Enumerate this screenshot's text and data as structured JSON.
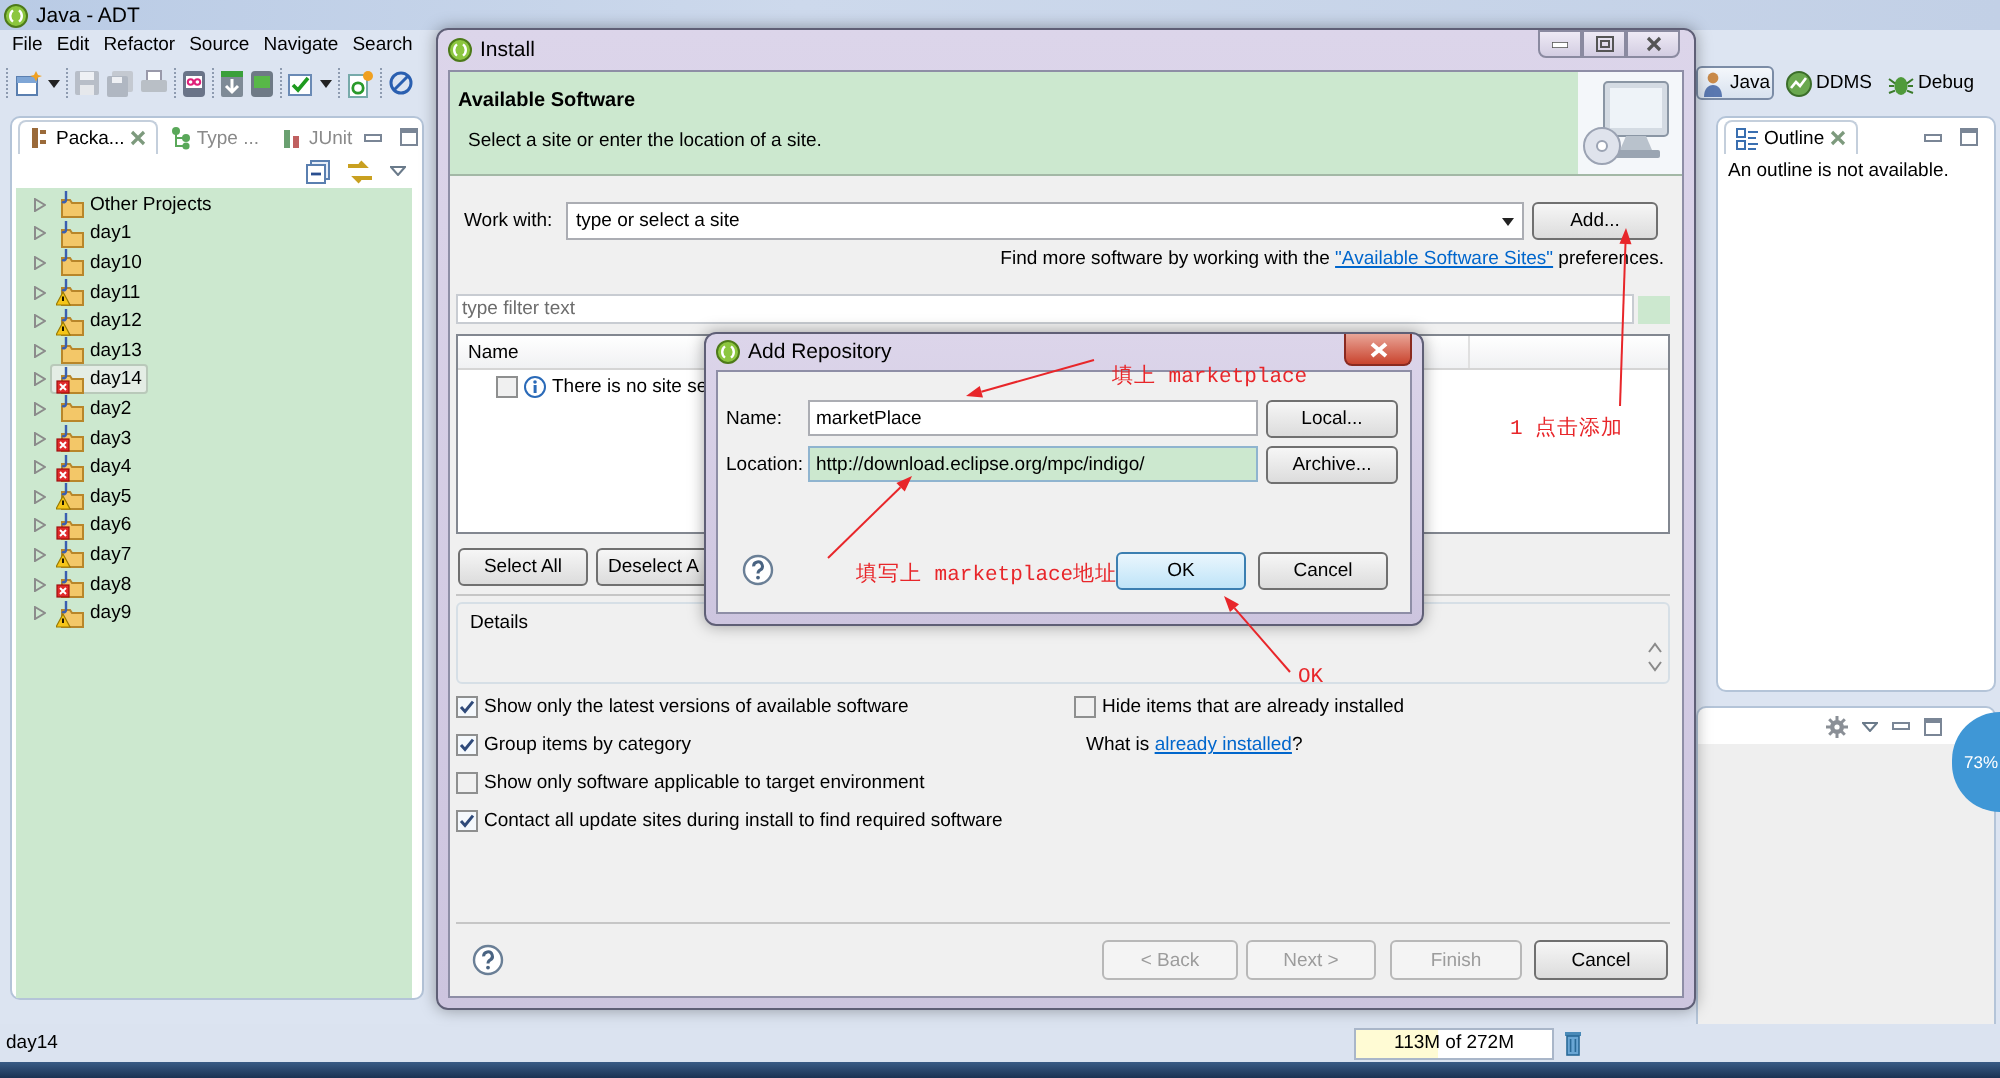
{
  "main_window": {
    "title": "Java - ADT",
    "menu": [
      "File",
      "Edit",
      "Refactor",
      "Source",
      "Navigate",
      "Search"
    ],
    "perspectives": [
      {
        "label": "Java",
        "selected": true
      },
      {
        "label": "DDMS",
        "selected": false
      },
      {
        "label": "Debug",
        "selected": false
      }
    ]
  },
  "package_explorer": {
    "tabs": [
      {
        "label": "Packa...",
        "selected": true
      },
      {
        "label": "Type ...",
        "selected": false
      },
      {
        "label": "JUnit",
        "selected": false
      }
    ],
    "items": [
      {
        "label": "Other Projects",
        "error": false,
        "warning": false,
        "selected": false
      },
      {
        "label": "day1",
        "error": false,
        "warning": false,
        "selected": false
      },
      {
        "label": "day10",
        "error": false,
        "warning": false,
        "selected": false
      },
      {
        "label": "day11",
        "error": false,
        "warning": true,
        "selected": false
      },
      {
        "label": "day12",
        "error": false,
        "warning": true,
        "selected": false
      },
      {
        "label": "day13",
        "error": false,
        "warning": false,
        "selected": false
      },
      {
        "label": "day14",
        "error": true,
        "warning": false,
        "selected": true
      },
      {
        "label": "day2",
        "error": false,
        "warning": false,
        "selected": false
      },
      {
        "label": "day3",
        "error": true,
        "warning": false,
        "selected": false
      },
      {
        "label": "day4",
        "error": true,
        "warning": false,
        "selected": false
      },
      {
        "label": "day5",
        "error": false,
        "warning": true,
        "selected": false
      },
      {
        "label": "day6",
        "error": true,
        "warning": false,
        "selected": false
      },
      {
        "label": "day7",
        "error": false,
        "warning": true,
        "selected": false
      },
      {
        "label": "day8",
        "error": true,
        "warning": false,
        "selected": false
      },
      {
        "label": "day9",
        "error": false,
        "warning": true,
        "selected": false
      }
    ]
  },
  "outline": {
    "tab": "Outline",
    "message": "An outline is not available."
  },
  "install_dialog": {
    "title": "Install",
    "header": {
      "title": "Available Software",
      "description": "Select a site or enter the location of a site."
    },
    "work_with": {
      "label": "Work with:",
      "value": "type or select a site",
      "button": "Add..."
    },
    "hint": {
      "before": "Find more software by working with the ",
      "link": "\"Available Software Sites\"",
      "after": " preferences."
    },
    "filter": {
      "placeholder": "type filter text"
    },
    "table": {
      "columns": [
        "Name"
      ],
      "rows": [
        {
          "checked": false,
          "text": "There is no site se"
        }
      ]
    },
    "selection_buttons": [
      "Select All",
      "Deselect A"
    ],
    "details": {
      "label": "Details"
    },
    "options": [
      {
        "label": "Show only the latest versions of available software",
        "checked": true
      },
      {
        "label": "Group items by category",
        "checked": true
      },
      {
        "label": "Show only software applicable to target environment",
        "checked": false
      },
      {
        "label": "Contact all update sites during install to find required software",
        "checked": true
      }
    ],
    "side_options": [
      {
        "label": "Hide items that are already installed",
        "checked": false
      }
    ],
    "installed_hint": {
      "before": "What is ",
      "link": "already installed",
      "after": "?"
    },
    "nav_buttons": [
      {
        "label": "< Back",
        "disabled": true
      },
      {
        "label": "Next >",
        "disabled": true
      },
      {
        "label": "Finish",
        "disabled": true
      },
      {
        "label": "Cancel",
        "disabled": false
      }
    ]
  },
  "add_repository_dialog": {
    "title": "Add Repository",
    "fields": [
      {
        "label": "Name:",
        "value": "marketPlace",
        "button": "Local...",
        "highlighted": false
      },
      {
        "label": "Location:",
        "value": "http://download.eclipse.org/mpc/indigo/",
        "button": "Archive...",
        "highlighted": true
      }
    ],
    "buttons": [
      {
        "label": "OK",
        "focused": true
      },
      {
        "label": "Cancel",
        "focused": false
      }
    ]
  },
  "annotations": [
    {
      "text": "填上 marketplace"
    },
    {
      "text": "1 点击添加"
    },
    {
      "text": "填写上 marketplace地址"
    },
    {
      "text": "OK"
    }
  ],
  "status_bar": {
    "selection": "day14",
    "memory": {
      "text": "113M of 272M",
      "level": 0.42
    }
  },
  "speed_badge": {
    "text": "73%"
  }
}
